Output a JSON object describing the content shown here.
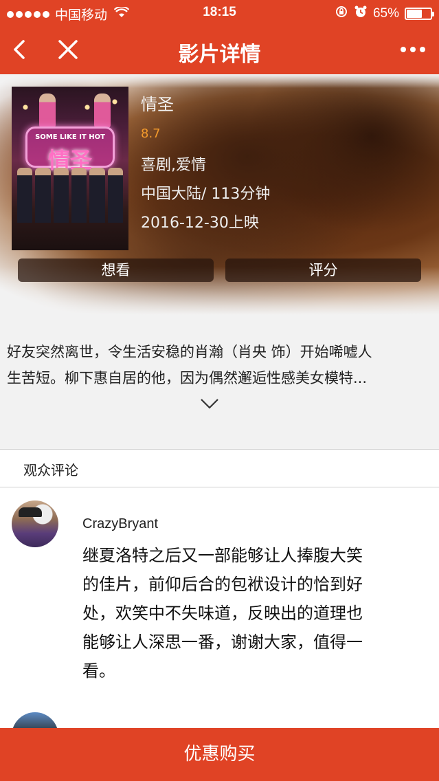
{
  "status_bar": {
    "carrier": "中国移动",
    "time": "18:15",
    "battery_percent": "65%",
    "battery_level": 0.65
  },
  "nav": {
    "title": "影片详情"
  },
  "movie": {
    "poster_title": "情圣",
    "poster_tagline": "SOME LIKE IT HOT",
    "name": "情圣",
    "score": "8.7",
    "genres": "喜剧,爱情",
    "region_duration": "中国大陆/ 113分钟",
    "release": "2016-12-30上映"
  },
  "actions": {
    "want_label": "想看",
    "rate_label": "评分"
  },
  "synopsis": {
    "line1": "好友突然离世，令生活安稳的肖瀚（肖央 饰）开始唏嘘人",
    "line2": "生苦短。柳下惠自居的他，因为偶然邂逅性感美女模特..."
  },
  "comments": {
    "header": "观众评论",
    "items": [
      {
        "user": "CrazyBryant",
        "lines": [
          "继夏洛特之后又一部能够让人捧腹大笑",
          "的佳片，前仰后合的包袱设计的恰到好",
          "处，欢笑中不失味道，反映出的道理也",
          "能够让人深思一番，谢谢大家，值得一",
          "看。"
        ]
      }
    ]
  },
  "buy": {
    "label": "优惠购买"
  },
  "colors": {
    "brand": "#e04325",
    "score": "#f39a2c"
  }
}
